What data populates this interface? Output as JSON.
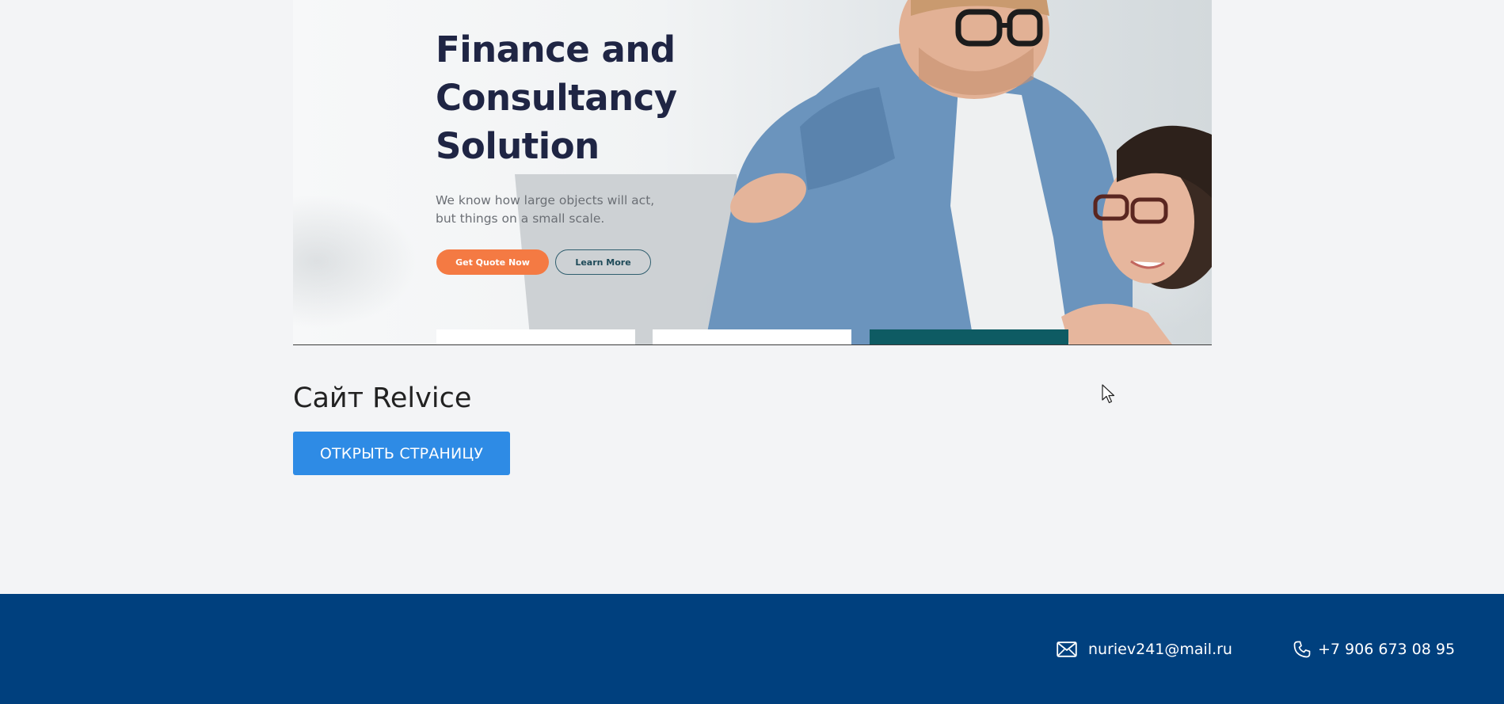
{
  "hero": {
    "title_line1": "Finance and",
    "title_line2": "Consultancy",
    "title_line3": "Solution",
    "subtitle_line1": "We know how large objects will act,",
    "subtitle_line2": "but things on a small scale.",
    "quote_button": "Get Quote Now",
    "learn_button": "Learn More"
  },
  "section": {
    "title": "Сайт Relvice",
    "open_button": "ОТКРЫТЬ СТРАНИЦУ"
  },
  "footer": {
    "email": "nuriev241@mail.ru",
    "phone": "+7 906 673 08 95",
    "email_icon": "envelope-icon",
    "phone_icon": "phone-icon"
  },
  "colors": {
    "page_background": "#f3f4f6",
    "title_color": "#1f2544",
    "quote_button": "#f47a43",
    "open_button": "#2e8be5",
    "footer": "#00407e",
    "card_accent": "#0e5b63"
  }
}
